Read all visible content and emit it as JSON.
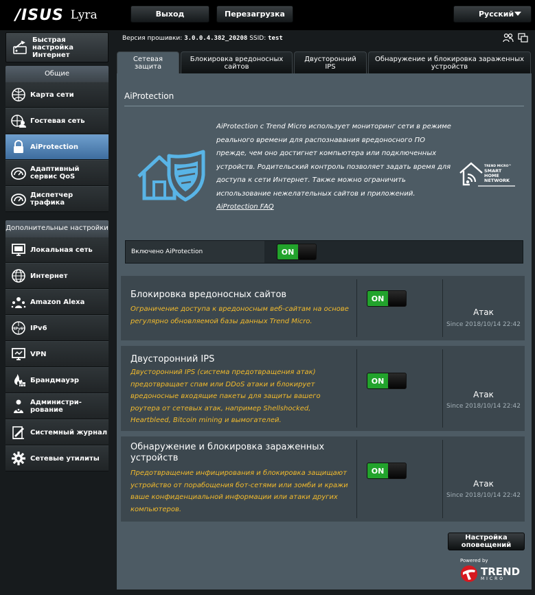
{
  "header": {
    "brand": "/ISUS",
    "model": "Lyra",
    "logout_label": "Выход",
    "reboot_label": "Перезагрузка",
    "language": "Русский"
  },
  "firmware": {
    "label": "Версия прошивки:",
    "version": "3.0.0.4.382_20208",
    "ssid_label": "SSID:",
    "ssid": "test"
  },
  "sidebar": {
    "quick_setup": "Быстрая настройка Интернет",
    "general_label": "Общие",
    "general_items": [
      {
        "label": "Карта сети",
        "icon": "network-map-icon"
      },
      {
        "label": "Гостевая сеть",
        "icon": "guest-network-icon"
      },
      {
        "label": "AiProtection",
        "icon": "lock-icon",
        "active": true
      },
      {
        "label": "Адаптивный сервис QoS",
        "icon": "gauge-icon"
      },
      {
        "label": "Диспетчер трафика",
        "icon": "gauge-icon"
      }
    ],
    "advanced_label": "Дополнительные настройки",
    "advanced_items": [
      {
        "label": "Локальная сеть",
        "icon": "monitor-icon"
      },
      {
        "label": "Интернет",
        "icon": "globe-icon"
      },
      {
        "label": "Amazon Alexa",
        "icon": "alexa-icon"
      },
      {
        "label": "IPv6",
        "icon": "ipv6-icon"
      },
      {
        "label": "VPN",
        "icon": "vpn-icon"
      },
      {
        "label": "Брандмауэр",
        "icon": "firewall-icon"
      },
      {
        "label": "Администри-рование",
        "icon": "admin-icon"
      },
      {
        "label": "Системный журнал",
        "icon": "log-icon"
      },
      {
        "label": "Сетевые утилиты",
        "icon": "gear-icon"
      }
    ]
  },
  "tabs": [
    {
      "label": "Сетевая защита",
      "active": true
    },
    {
      "label": "Блокировка вредоносных сайтов",
      "active": false
    },
    {
      "label": "Двусторонний IPS",
      "active": false
    },
    {
      "label": "Обнаружение и блокировка зараженных устройств",
      "active": false
    }
  ],
  "panel": {
    "title": "AiProtection",
    "intro": "AiProtection с Trend Micro использует мониторинг сети в режиме реального времени для распознавания вредоносного ПО прежде, чем оно достигнет компьютера или подключенных устройств. Родительский контроль позволяет задать время для доступа к сети Интернет. Также можно ограничить использование нежелательных сайтов и приложений.",
    "faq_link": "AiProtection FAQ",
    "badge_lines": [
      "TREND MICRO™",
      "SMART",
      "HOME",
      "NETWORK"
    ],
    "enable_label": "Включено AiProtection",
    "enable_state": "ON"
  },
  "features": [
    {
      "title": "Блокировка вредоносных сайтов",
      "desc": "Ограничение доступа к вредоносным веб-сайтам на основе регулярно обновляемой базы данных Trend Micro.",
      "state": "ON",
      "attack_label": "Атак",
      "since": "Since 2018/10/14 22:42"
    },
    {
      "title": "Двусторонний IPS",
      "desc": "Двусторонний IPS (система предотвращения атак) предотвращает спам или DDoS атаки и блокирует вредоносные входящие пакеты для защиты вашего роутера от сетевых атак, например Shellshocked, Heartbleed, Bitcoin mining и вымогателей.",
      "state": "ON",
      "attack_label": "Атак",
      "since": "Since 2018/10/14 22:42"
    },
    {
      "title": "Обнаружение и блокировка зараженных устройств",
      "desc": "Предотвращение инфицирования и блокировка защищают устройство от порабощения бот-сетями или зомби и кражи ваше конфиденциальной информации или атаки других компьютеров.",
      "state": "ON",
      "attack_label": "Атак",
      "since": "Since 2018/10/14 22:42"
    }
  ],
  "footer": {
    "notify_button": "Настройка оповещений",
    "powered_by": "Powered by",
    "trend_word": "TREND",
    "trend_sub": "MICRO"
  },
  "colors": {
    "accent_orange": "#f3bb2c",
    "toggle_green": "#22a32c",
    "active_menu": "#5d8dbe",
    "panel": "#4d5b64",
    "trend_red": "#d71920"
  }
}
